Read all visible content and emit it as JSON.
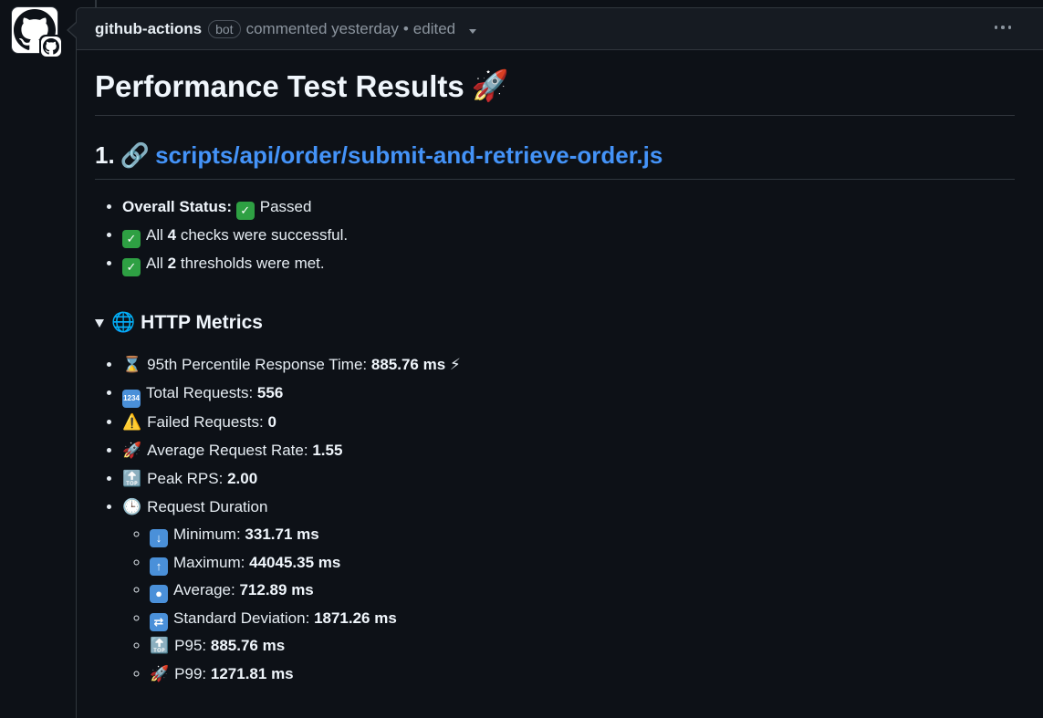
{
  "comment": {
    "author": "github-actions",
    "badge": "bot",
    "action": "commented yesterday",
    "separator": "•",
    "edited": "edited"
  },
  "content": {
    "title": "Performance Test Results",
    "title_emoji": "🚀",
    "section": {
      "number": "1.",
      "link_emoji": "🔗",
      "link_text": "scripts/api/order/submit-and-retrieve-order.js"
    },
    "status": {
      "label": "Overall Status:",
      "value": "Passed",
      "checks_prefix": "All",
      "checks_count": "4",
      "checks_suffix": "checks were successful.",
      "thresholds_prefix": "All",
      "thresholds_count": "2",
      "thresholds_suffix": "thresholds were met."
    },
    "http_metrics": {
      "summary_label": "HTTP Metrics",
      "summary_emoji": "🌐",
      "items": [
        {
          "icon": "⌛",
          "label": "95th Percentile Response Time:",
          "value": "885.76 ms",
          "suffix": "⚡"
        },
        {
          "icon": "🔢",
          "label": "Total Requests:",
          "value": "556",
          "suffix": ""
        },
        {
          "icon": "⚠️",
          "label": "Failed Requests:",
          "value": "0",
          "suffix": ""
        },
        {
          "icon": "🚀",
          "label": "Average Request Rate:",
          "value": "1.55",
          "suffix": ""
        },
        {
          "icon": "🔝",
          "label": "Peak RPS:",
          "value": "2.00",
          "suffix": ""
        }
      ],
      "duration": {
        "icon": "🕒",
        "label": "Request Duration",
        "items": [
          {
            "icon": "⬇️",
            "label": "Minimum:",
            "value": "331.71 ms"
          },
          {
            "icon": "⬆️",
            "label": "Maximum:",
            "value": "44045.35 ms"
          },
          {
            "icon": "⏺️",
            "label": "Average:",
            "value": "712.89 ms"
          },
          {
            "icon": "🔀",
            "label": "Standard Deviation:",
            "value": "1871.26 ms"
          },
          {
            "icon": "🔝",
            "label": "P95:",
            "value": "885.76 ms"
          },
          {
            "icon": "🚀",
            "label": "P99:",
            "value": "1271.81 ms"
          }
        ]
      }
    }
  },
  "colors": {
    "background": "#0d1117",
    "header_bg": "#161b22",
    "border": "#30363d",
    "link": "#4493f8",
    "check_green": "#2ea043"
  }
}
